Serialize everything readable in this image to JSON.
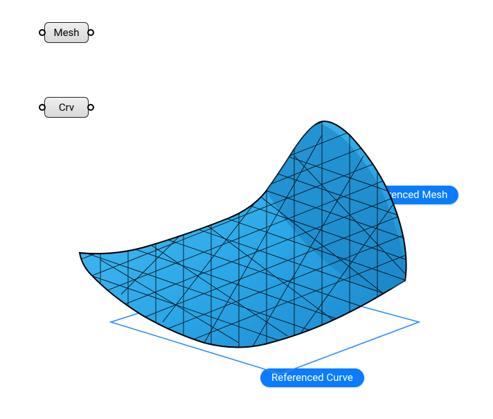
{
  "params": {
    "mesh": {
      "label": "Mesh"
    },
    "curve": {
      "label": "Crv"
    }
  },
  "tags": {
    "mesh": {
      "label": "Referenced Mesh"
    },
    "curve": {
      "label": "Referenced Curve"
    }
  },
  "colors": {
    "tag_bg": "#0a7cff",
    "mesh_fill_light": "#3bb7f2",
    "mesh_fill_dark": "#1a8fd4",
    "mesh_edge": "#000000",
    "curve_stroke": "#1e90ff"
  }
}
